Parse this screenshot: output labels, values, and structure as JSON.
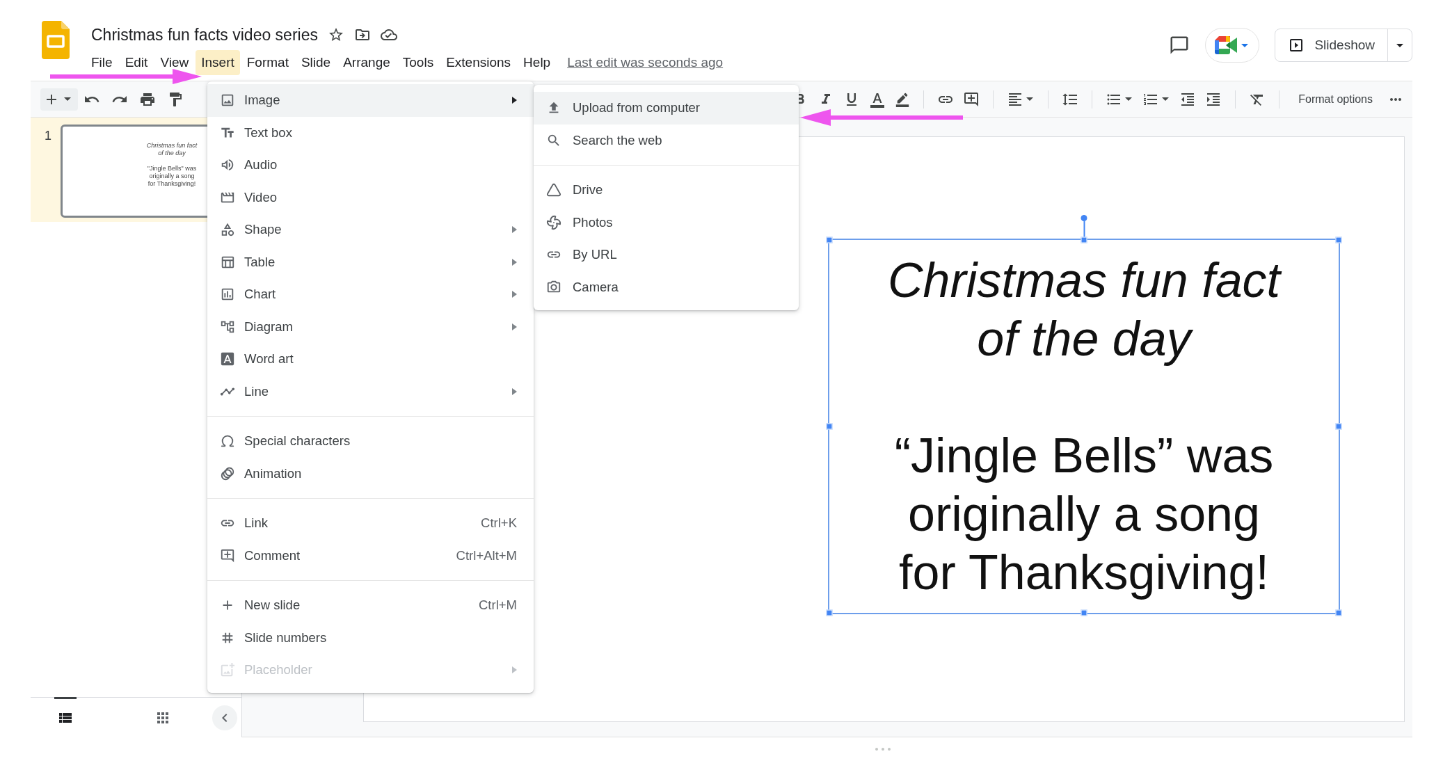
{
  "document": {
    "title": "Christmas fun facts video series"
  },
  "menu_bar": [
    {
      "label": "File",
      "selected": false
    },
    {
      "label": "Edit",
      "selected": false
    },
    {
      "label": "View",
      "selected": false
    },
    {
      "label": "Insert",
      "selected": true
    },
    {
      "label": "Format",
      "selected": false
    },
    {
      "label": "Slide",
      "selected": false
    },
    {
      "label": "Arrange",
      "selected": false
    },
    {
      "label": "Tools",
      "selected": false
    },
    {
      "label": "Extensions",
      "selected": false
    },
    {
      "label": "Help",
      "selected": false
    }
  ],
  "last_edit": "Last edit was seconds ago",
  "slideshow_button": "Slideshow",
  "toolbar": {
    "format_options": "Format options"
  },
  "filmstrip": {
    "slides": [
      {
        "number": "1",
        "selected": true,
        "title": "Christmas fun fact of the day",
        "body": "\"Jingle Bells\" was originally a song for Thanksgiving!"
      }
    ],
    "views": [
      {
        "kind": "list",
        "selected": true
      },
      {
        "kind": "grid",
        "selected": false
      }
    ]
  },
  "insert_menu": {
    "sections": [
      [
        {
          "label": "Image",
          "submenu": true,
          "highlighted": true,
          "disabled": false
        },
        {
          "label": "Text box",
          "submenu": false,
          "highlighted": false,
          "disabled": false
        },
        {
          "label": "Audio",
          "submenu": false,
          "highlighted": false,
          "disabled": false
        },
        {
          "label": "Video",
          "submenu": false,
          "highlighted": false,
          "disabled": false
        },
        {
          "label": "Shape",
          "submenu": true,
          "highlighted": false,
          "disabled": false
        },
        {
          "label": "Table",
          "submenu": true,
          "highlighted": false,
          "disabled": false
        },
        {
          "label": "Chart",
          "submenu": true,
          "highlighted": false,
          "disabled": false
        },
        {
          "label": "Diagram",
          "submenu": true,
          "highlighted": false,
          "disabled": false
        },
        {
          "label": "Word art",
          "submenu": false,
          "highlighted": false,
          "disabled": false
        },
        {
          "label": "Line",
          "submenu": true,
          "highlighted": false,
          "disabled": false
        }
      ],
      [
        {
          "label": "Special characters",
          "submenu": false,
          "highlighted": false,
          "disabled": false
        },
        {
          "label": "Animation",
          "submenu": false,
          "highlighted": false,
          "disabled": false
        }
      ],
      [
        {
          "label": "Link",
          "shortcut": "Ctrl+K",
          "submenu": false,
          "highlighted": false,
          "disabled": false
        },
        {
          "label": "Comment",
          "shortcut": "Ctrl+Alt+M",
          "submenu": false,
          "highlighted": false,
          "disabled": false
        }
      ],
      [
        {
          "label": "New slide",
          "shortcut": "Ctrl+M",
          "submenu": false,
          "highlighted": false,
          "disabled": false
        },
        {
          "label": "Slide numbers",
          "submenu": false,
          "highlighted": false,
          "disabled": false
        },
        {
          "label": "Placeholder",
          "submenu": true,
          "highlighted": false,
          "disabled": true
        }
      ]
    ]
  },
  "image_submenu": {
    "sections": [
      [
        {
          "label": "Upload from computer",
          "highlighted": true
        },
        {
          "label": "Search the web",
          "highlighted": false
        }
      ],
      [
        {
          "label": "Drive",
          "highlighted": false
        },
        {
          "label": "Photos",
          "highlighted": false
        },
        {
          "label": "By URL",
          "highlighted": false
        },
        {
          "label": "Camera",
          "highlighted": false
        }
      ]
    ]
  },
  "slide": {
    "text_box": {
      "selected": true,
      "title": "Christmas fun fact of the day",
      "body": "“Jingle Bells” was originally a song for Thanksgiving!"
    }
  }
}
